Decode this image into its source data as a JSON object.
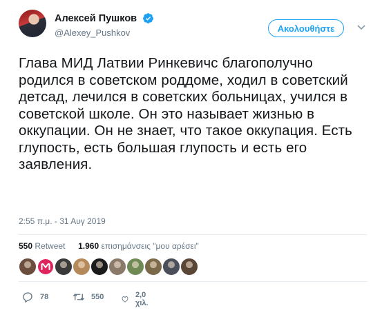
{
  "author": {
    "display_name": "Алексей Пушков",
    "handle": "@Alexey_Pushkov",
    "verified": true
  },
  "follow_button": {
    "label": "Ακολουθήστε"
  },
  "tweet": {
    "text": "Глава МИД Латвии Ринкевичс благополучно родился в советском роддоме, ходил в советский детсад, лечился в советских больницах, учился в советской школе. Он это называет жизнью в оккупации. Он не знает, что такое оккупация. Есть глупость, есть большая глупость и есть его заявления.",
    "timestamp": "2:55 π.μ. - 31 Αυγ 2019"
  },
  "stats": {
    "retweets_count": "550",
    "retweets_label": "Retweet",
    "likes_count": "1.960",
    "likes_label": "επισημάνσεις \"μου αρέσει\""
  },
  "likers": [
    {
      "color": "#6b4e3d"
    },
    {
      "color": "#e0245e",
      "badge": "m"
    },
    {
      "color": "#3a3a3a"
    },
    {
      "color": "#b58a5a"
    },
    {
      "color": "#1b1b1b"
    },
    {
      "color": "#8a7a6a"
    },
    {
      "color": "#6f8a55"
    },
    {
      "color": "#7a6a4a"
    },
    {
      "color": "#4a4f5a"
    },
    {
      "color": "#5a4636"
    }
  ],
  "actions": {
    "replies": "78",
    "retweets": "550",
    "likes": "2,0 χιλ."
  },
  "icons": {
    "verified": "verified-badge-icon",
    "caret": "chevron-down-icon",
    "reply": "reply-icon",
    "retweet": "retweet-icon",
    "like": "heart-icon"
  },
  "colors": {
    "accent": "#1da1f2",
    "text": "#14171a",
    "muted": "#657786"
  }
}
